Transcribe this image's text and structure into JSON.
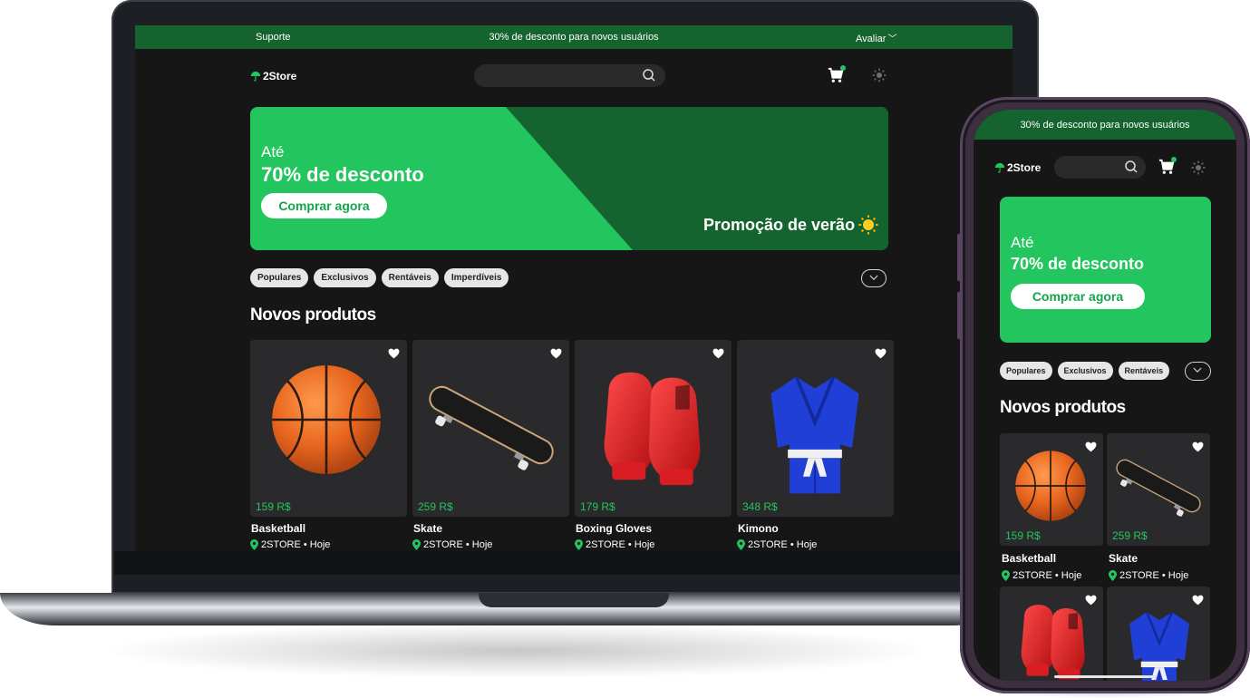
{
  "colors": {
    "brand_green": "#22c55e",
    "dark_green": "#15632f",
    "background": "#161616",
    "card": "#2a2a2c"
  },
  "laptop": {
    "topbar": {
      "support": "Suporte",
      "promo": "30% de desconto para novos usuários",
      "rate": "Avaliar"
    },
    "header": {
      "logo": "2Store",
      "search_placeholder": ""
    },
    "banner": {
      "line1": "Até",
      "line2": "70% de desconto",
      "cta": "Comprar agora",
      "tagline": "Promoção de verão"
    },
    "categories": [
      "Populares",
      "Exclusivos",
      "Rentáveis",
      "Imperdíveis"
    ],
    "section_title": "Novos produtos",
    "products": [
      {
        "name": "Basketball",
        "price": "159 R$",
        "seller": "2STORE • Hoje",
        "image": "basketball"
      },
      {
        "name": "Skate",
        "price": "259 R$",
        "seller": "2STORE • Hoje",
        "image": "skateboard"
      },
      {
        "name": "Boxing Gloves",
        "price": "179 R$",
        "seller": "2STORE • Hoje",
        "image": "boxing-gloves"
      },
      {
        "name": "Kimono",
        "price": "348 R$",
        "seller": "2STORE • Hoje",
        "image": "kimono"
      }
    ]
  },
  "phone": {
    "topbar": {
      "promo": "30% de desconto para novos usuários"
    },
    "header": {
      "logo": "2Store",
      "search_placeholder": ""
    },
    "banner": {
      "line1": "Até",
      "line2": "70% de desconto",
      "cta": "Comprar agora"
    },
    "categories": [
      "Populares",
      "Exclusivos",
      "Rentáveis"
    ],
    "section_title": "Novos produtos",
    "products": [
      {
        "name": "Basketball",
        "price": "159 R$",
        "seller": "2STORE • Hoje",
        "image": "basketball"
      },
      {
        "name": "Skate",
        "price": "259 R$",
        "seller": "2STORE • Hoje",
        "image": "skateboard"
      },
      {
        "name": "",
        "price": "",
        "seller": "",
        "image": "boxing-gloves"
      },
      {
        "name": "",
        "price": "",
        "seller": "",
        "image": "kimono"
      }
    ]
  }
}
